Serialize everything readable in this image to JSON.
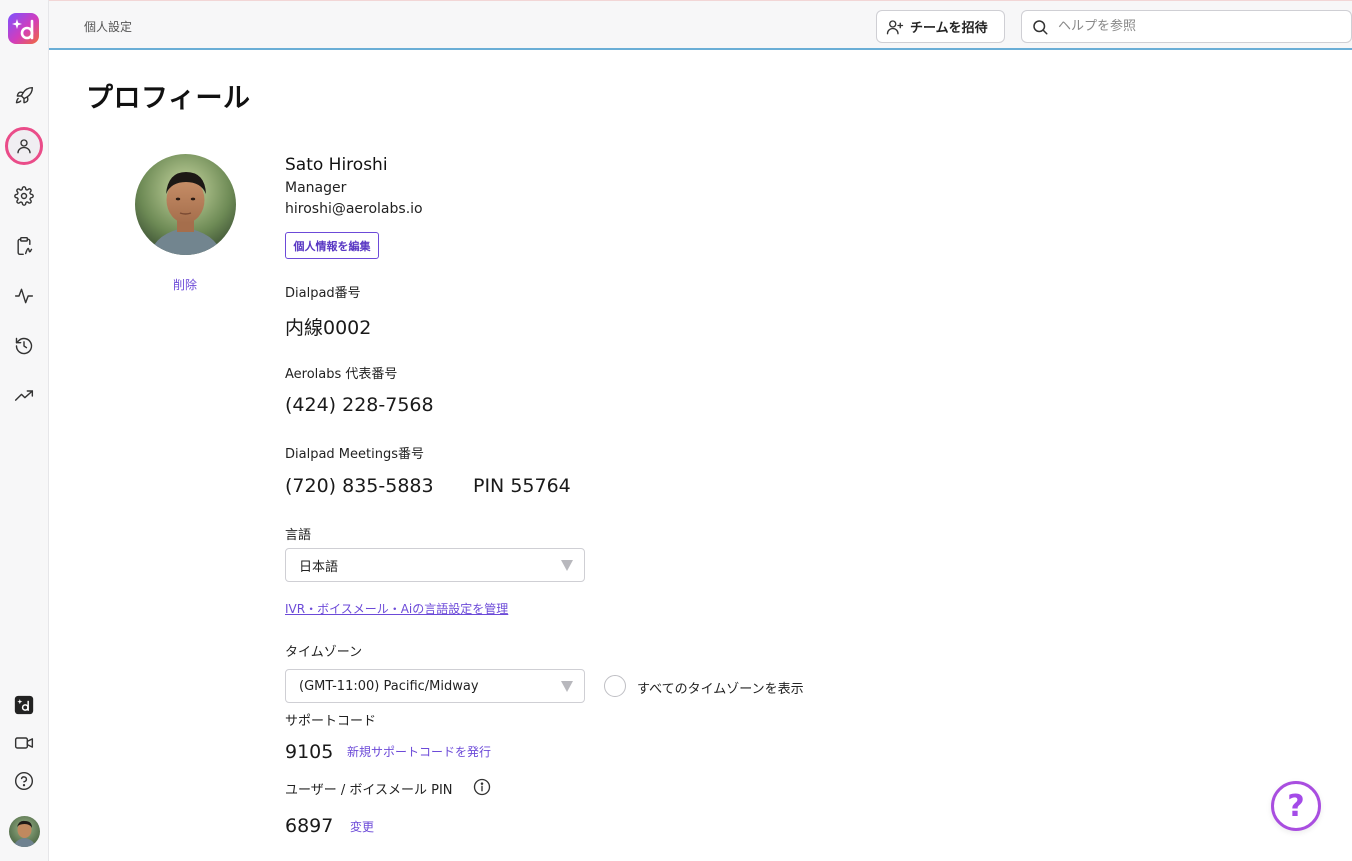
{
  "topbar": {
    "breadcrumb": "個人設定",
    "invite_label": "チームを招待",
    "search_placeholder": "ヘルプを参照"
  },
  "rail": {
    "icons": [
      "rocket-icon",
      "user-icon",
      "gear-icon",
      "clipboard-icon",
      "activity-icon",
      "history-icon",
      "trending-icon",
      "dialpad-app-icon",
      "video-icon",
      "help-circle-icon"
    ],
    "active": "user-icon"
  },
  "profile": {
    "page_title": "プロフィール",
    "name": "Sato Hiroshi",
    "role": "Manager",
    "email": "hiroshi@aerolabs.io",
    "edit_label": "個人情報を編集",
    "delete_label": "削除"
  },
  "dialpad_number": {
    "label": "Dialpad番号",
    "value": "内線0002"
  },
  "main_number": {
    "label": "Aerolabs 代表番号",
    "value": "(424) 228-7568"
  },
  "meetings": {
    "label": "Dialpad Meetings番号",
    "number": "(720) 835-5883",
    "pin": "PIN 55764"
  },
  "language": {
    "label": "言語",
    "selected": "日本語",
    "manage_link": "IVR・ボイスメール・Aiの言語設定を管理"
  },
  "timezone": {
    "label": "タイムゾーン",
    "selected": "(GMT-11:00) Pacific/Midway",
    "show_all_label": "すべてのタイムゾーンを表示"
  },
  "support_code": {
    "label": "サポートコード",
    "value": "9105",
    "new_link": "新規サポートコードを発行"
  },
  "pin": {
    "label": "ユーザー / ボイスメール PIN",
    "value": "6897",
    "change_link": "変更"
  },
  "help_fab": "?",
  "colors": {
    "accent": "#6c4ad8",
    "active_ring": "#ea4c89",
    "topbar_border": "#6aaed6"
  }
}
